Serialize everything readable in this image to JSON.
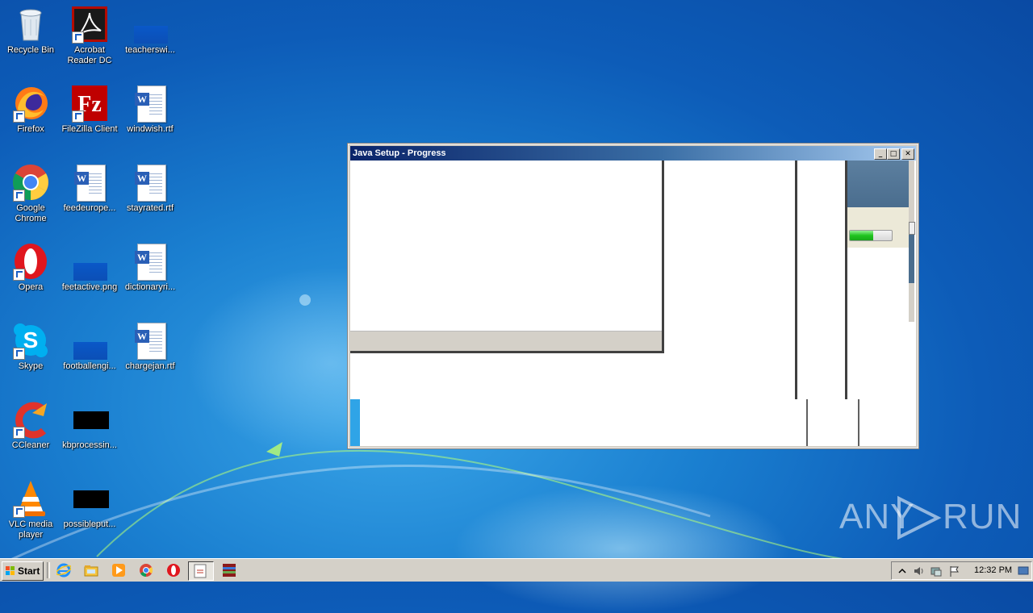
{
  "desktop": {
    "icons": [
      {
        "label": "Recycle Bin",
        "icon": "recycle-bin-icon"
      },
      {
        "label": "Acrobat Reader DC",
        "icon": "acrobat-icon"
      },
      {
        "label": "teacherswi...",
        "icon": "image-file-icon"
      },
      {
        "label": "Firefox",
        "icon": "firefox-icon"
      },
      {
        "label": "FileZilla Client",
        "icon": "filezilla-icon"
      },
      {
        "label": "windwish.rtf",
        "icon": "word-doc-icon"
      },
      {
        "label": "Google Chrome",
        "icon": "chrome-icon"
      },
      {
        "label": "feedeurope...",
        "icon": "word-doc-icon"
      },
      {
        "label": "stayrated.rtf",
        "icon": "word-doc-icon"
      },
      {
        "label": "Opera",
        "icon": "opera-icon"
      },
      {
        "label": "feetactive.png",
        "icon": "image-file-icon"
      },
      {
        "label": "dictionaryri...",
        "icon": "word-doc-icon"
      },
      {
        "label": "Skype",
        "icon": "skype-icon"
      },
      {
        "label": "footballengi...",
        "icon": "image-file-icon"
      },
      {
        "label": "chargejan.rtf",
        "icon": "word-doc-icon"
      },
      {
        "label": "CCleaner",
        "icon": "ccleaner-icon"
      },
      {
        "label": "kbprocessin...",
        "icon": "black-file-icon"
      },
      {
        "label": "VLC media player",
        "icon": "vlc-icon"
      },
      {
        "label": "possibleput...",
        "icon": "black-file-icon"
      }
    ]
  },
  "window": {
    "title": "Java Setup - Progress",
    "minimize_glyph": "_",
    "maximize_glyph": "□",
    "close_glyph": "✕",
    "progress_fraction": 0.55
  },
  "taskbar": {
    "start_label": "Start",
    "quick_launch": [
      "ie-icon",
      "explorer-icon",
      "media-player-icon",
      "chrome-icon",
      "opera-icon"
    ],
    "tasks": [
      "java-setup-icon",
      "winrar-icon"
    ],
    "clock": "12:32 PM"
  },
  "watermark": {
    "left": "ANY",
    "right": "RUN"
  },
  "colors": {
    "accent": "#2fa4e7",
    "titlebar_start": "#0a246a",
    "progress_green": "#1fc41f"
  }
}
